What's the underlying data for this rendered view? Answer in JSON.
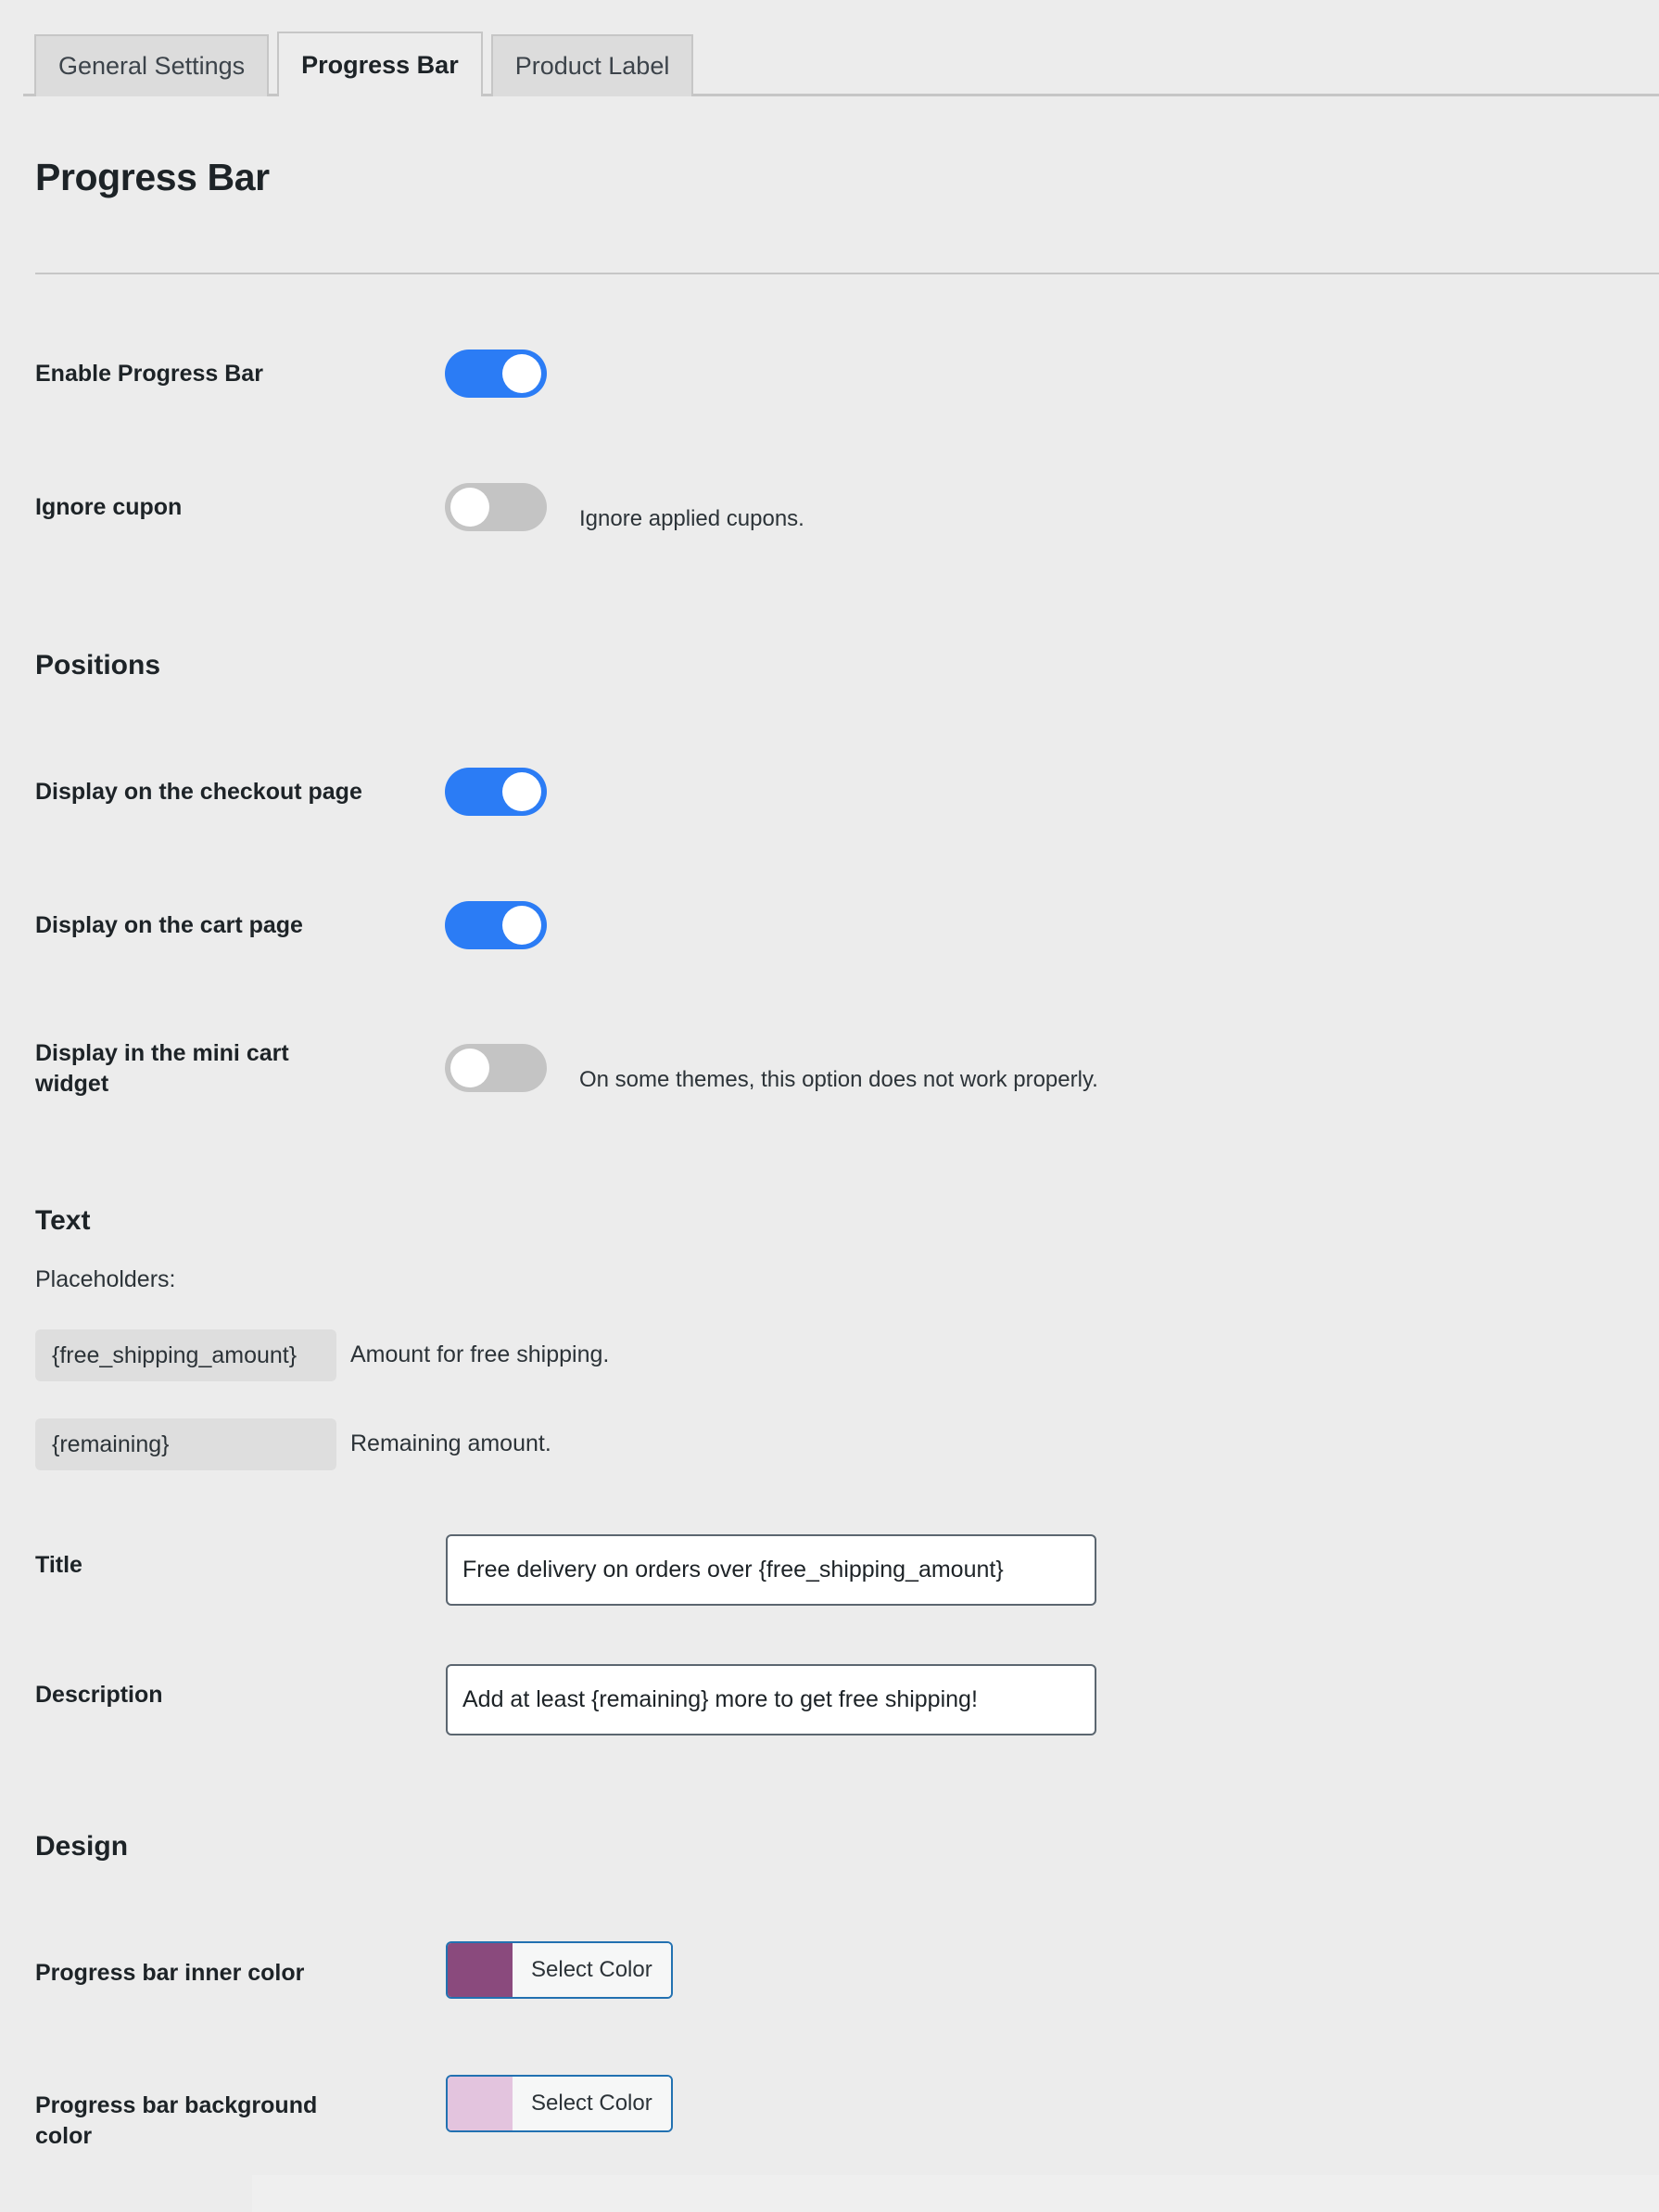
{
  "tabs": [
    {
      "label": "General Settings",
      "active": false
    },
    {
      "label": "Progress Bar",
      "active": true
    },
    {
      "label": "Product Label",
      "active": false
    }
  ],
  "page": {
    "title": "Progress Bar"
  },
  "settings": {
    "enable_progress_bar": {
      "label": "Enable Progress Bar",
      "state": "on"
    },
    "ignore_cupon": {
      "label": "Ignore cupon",
      "state": "off",
      "help": "Ignore applied cupons."
    }
  },
  "positions": {
    "heading": "Positions",
    "checkout_page": {
      "label": "Display on the checkout page",
      "state": "on"
    },
    "cart_page": {
      "label": "Display on the cart page",
      "state": "on"
    },
    "mini_cart_widget": {
      "label": "Display in the mini cart widget",
      "state": "off",
      "help": "On some themes, this option does not work properly."
    }
  },
  "text": {
    "heading": "Text",
    "placeholders_label": "Placeholders:",
    "placeholders": [
      {
        "token": "{free_shipping_amount}",
        "description": "Amount for free shipping."
      },
      {
        "token": "{remaining}",
        "description": "Remaining amount."
      }
    ],
    "title_field": {
      "label": "Title",
      "value": "Free delivery on orders over {free_shipping_amount}"
    },
    "description_field": {
      "label": "Description",
      "value": "Add at least {remaining} more to get free shipping!"
    }
  },
  "design": {
    "heading": "Design",
    "inner_color": {
      "label": "Progress bar inner color",
      "button_label": "Select Color",
      "value": "#8a4a7d"
    },
    "background_color": {
      "label": "Progress bar background color",
      "button_label": "Select Color",
      "value": "#e3c4de"
    }
  },
  "theme": {
    "page_background": "#ececec",
    "toggle_on": "#2b7cf5",
    "toggle_off": "#c4c4c4",
    "accent_border": "#2271b1",
    "input_border": "#5b6670",
    "chip_background": "#dedede"
  }
}
